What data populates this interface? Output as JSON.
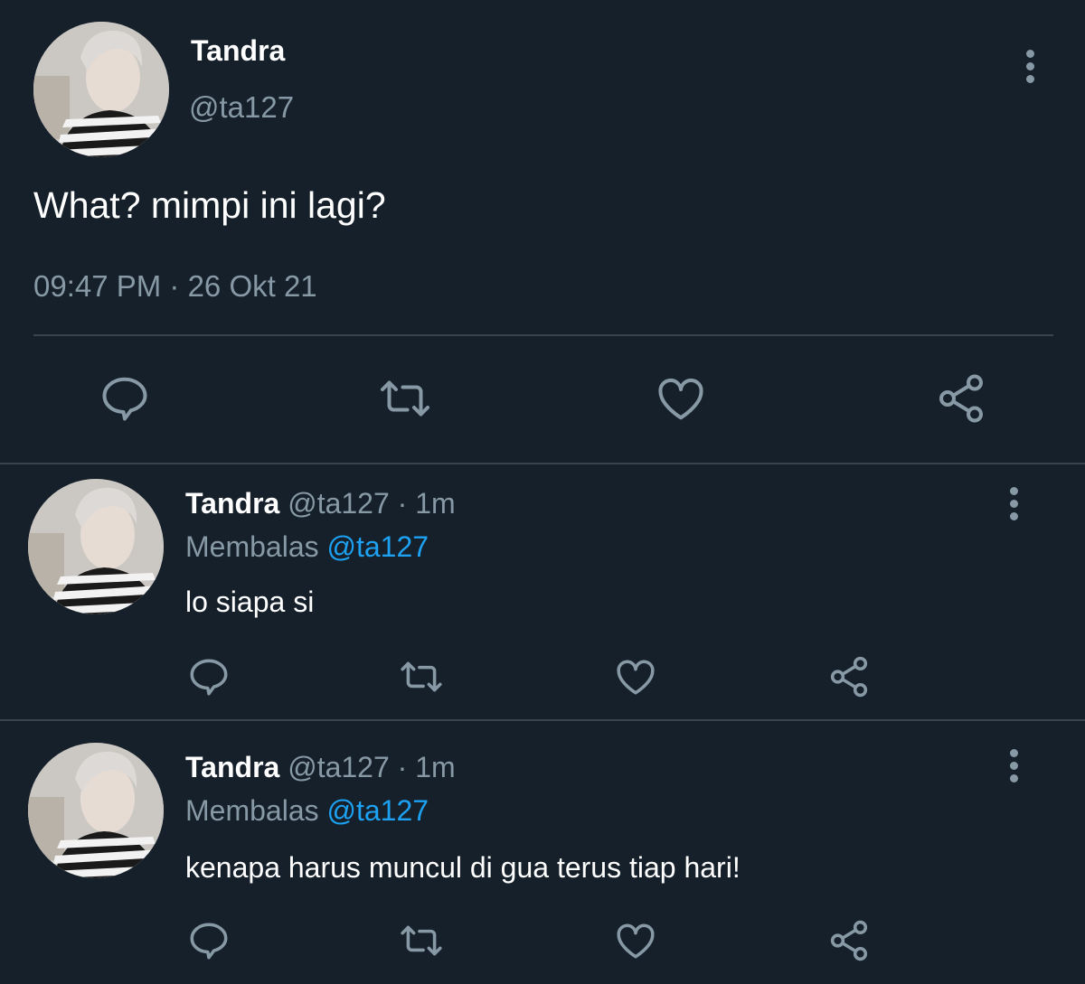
{
  "main_tweet": {
    "author_name": "Tandra",
    "author_handle": "@ta127",
    "text": "What? mimpi ini lagi?",
    "timestamp": "09:47 PM · 26 Okt 21",
    "icons": [
      "reply-icon",
      "retweet-icon",
      "like-icon",
      "share-icon",
      "more-options-icon"
    ]
  },
  "replies": [
    {
      "author_name": "Tandra",
      "author_handle": "@ta127",
      "separator": "·",
      "time": "1m",
      "replying_to_label": "Membalas",
      "replying_to_handle": "@ta127",
      "text": "lo siapa si"
    },
    {
      "author_name": "Tandra",
      "author_handle": "@ta127",
      "separator": "·",
      "time": "1m",
      "replying_to_label": "Membalas",
      "replying_to_handle": "@ta127",
      "text": "kenapa harus muncul di gua terus tiap hari!"
    }
  ],
  "colors": {
    "background": "#15202b",
    "primary_text": "#ffffff",
    "secondary_text": "#8899a6",
    "mention": "#1da1f2",
    "divider": "#38444d"
  }
}
